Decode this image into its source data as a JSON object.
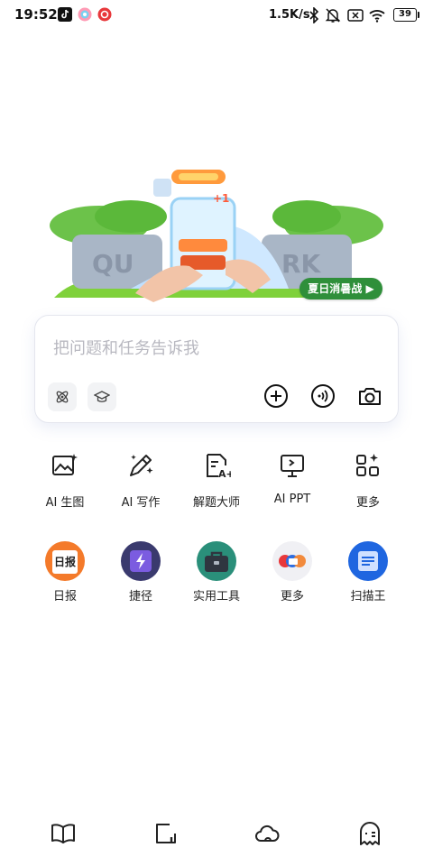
{
  "status": {
    "time": "19:52",
    "net_speed": "1.5K/s",
    "battery": "39"
  },
  "hero": {
    "badge": "夏日消暑战 ▶"
  },
  "search": {
    "placeholder": "把问题和任务告诉我"
  },
  "tools": [
    {
      "label": "AI 生图",
      "icon": "image-sparkle-icon"
    },
    {
      "label": "AI 写作",
      "icon": "pen-sparkle-icon"
    },
    {
      "label": "解题大师",
      "icon": "document-grade-icon"
    },
    {
      "label": "AI PPT",
      "icon": "presentation-icon"
    },
    {
      "label": "更多",
      "icon": "apps-grid-icon"
    }
  ],
  "apps": [
    {
      "label": "日报",
      "icon": "daily-news-icon",
      "icon_text": "日报",
      "color": "#f47a2a"
    },
    {
      "label": "捷径",
      "icon": "shortcut-lightning-icon",
      "color": "#3a3a6e"
    },
    {
      "label": "实用工具",
      "icon": "toolbox-icon",
      "color": "#2a8f7a"
    },
    {
      "label": "更多",
      "icon": "more-apps-icon",
      "color": "#f0f0f4"
    },
    {
      "label": "扫描王",
      "icon": "scanner-icon",
      "color": "#1f66e0"
    }
  ],
  "nav": [
    {
      "icon": "book-icon"
    },
    {
      "icon": "note-icon"
    },
    {
      "icon": "cloud-icon"
    },
    {
      "icon": "assistant-ghost-icon"
    }
  ]
}
